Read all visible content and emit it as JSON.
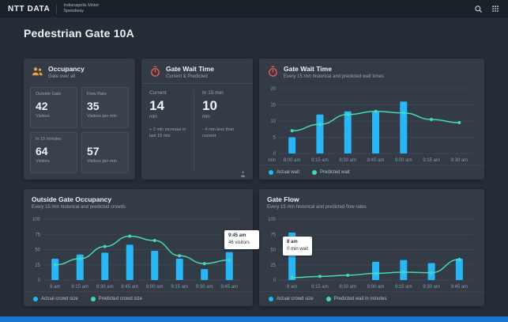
{
  "topbar": {
    "logo": "NTT DATA",
    "org_line1": "Indianapolis Motor",
    "org_line2": "Speedway"
  },
  "page": {
    "title": "Pedestrian Gate 10A"
  },
  "colors": {
    "accent_blue": "#29b6f6",
    "accent_teal": "#43d9b8",
    "icon_orange": "#f0a13c",
    "icon_red": "#ff5b50",
    "bottom_bar": "#1976d2"
  },
  "occupancy_card": {
    "title": "Occupancy",
    "subtitle": "Gate over all",
    "stats": [
      {
        "label": "Outside Gate",
        "value": "42",
        "unit": "Visitors"
      },
      {
        "label": "Flow Rate",
        "value": "35",
        "unit": "Visitors per min"
      },
      {
        "label": "In 15 minutes",
        "value": "64",
        "unit": "Visitors"
      },
      {
        "label": "",
        "value": "57",
        "unit": "Visitors per min"
      }
    ]
  },
  "wait_card": {
    "title": "Gate Wait Time",
    "subtitle": "Current & Predicted",
    "current": {
      "label": "Current",
      "value": "14",
      "unit": "min",
      "note": "+ 2 min increase in last 15 min"
    },
    "predicted": {
      "label": "In 15 min",
      "value": "10",
      "unit": "min",
      "note": "- 4 min less than current"
    }
  },
  "charts": [
    {
      "title": "Gate Wait Time",
      "subtitle": "Every 15 min historical and predicted wait times",
      "chart": {
        "type": "bar+line",
        "categories": [
          "8:00 am",
          "8:15 am",
          "8:30 am",
          "8:45 am",
          "9:00 am",
          "9:15 am",
          "9:30 am"
        ],
        "y_ticks": [
          0,
          5,
          10,
          15,
          20
        ],
        "y_unit": "min",
        "grid": true,
        "legend_position": "bottom",
        "series": [
          {
            "name": "Actual wait",
            "type": "bar",
            "color": "#29b6f6",
            "values": [
              5,
              12,
              13,
              13,
              16,
              null,
              null
            ]
          },
          {
            "name": "Predicted wait",
            "type": "line",
            "color": "#43d9b8",
            "values": [
              7,
              9,
              12,
              13,
              12.5,
              10.5,
              9.5
            ]
          }
        ]
      }
    },
    {
      "title": "Outside Gate Occupancy",
      "subtitle": "Every 15 min historical and predicted crowds",
      "chart": {
        "type": "bar+line",
        "categories": [
          "8 am",
          "8:15 am",
          "8:30 am",
          "8:45 am",
          "9:00 am",
          "9:15 am",
          "9:30 am",
          "9:45 am"
        ],
        "y_ticks": [
          0,
          25,
          50,
          75,
          100
        ],
        "y_unit": "",
        "grid": true,
        "legend_position": "bottom",
        "series": [
          {
            "name": "Actual crowd size",
            "type": "bar",
            "color": "#29b6f6",
            "values": [
              35,
              42,
              45,
              58,
              48,
              35,
              18,
              46
            ]
          },
          {
            "name": "Predicted crowd size",
            "type": "line",
            "color": "#43d9b8",
            "values": [
              25,
              35,
              55,
              72,
              65,
              40,
              27,
              33
            ]
          }
        ]
      },
      "tooltip": {
        "title": "9:45 am",
        "text": "46 visitors"
      }
    },
    {
      "title": "Gate Flow",
      "subtitle": "Every 15 min historical and predicted flow rates",
      "chart": {
        "type": "bar+line",
        "categories": [
          "8 am",
          "8:15 am",
          "8:30 am",
          "9:00 am",
          "9:15 am",
          "9:30 am",
          "9:45 am"
        ],
        "y_ticks": [
          0,
          25,
          50,
          75,
          100
        ],
        "y_unit": "",
        "grid": true,
        "legend_position": "bottom",
        "series": [
          {
            "name": "Actual crowd size",
            "type": "bar",
            "color": "#29b6f6",
            "values": [
              78,
              null,
              null,
              30,
              33,
              28,
              35
            ]
          },
          {
            "name": "Predicted wait in minutes",
            "type": "line",
            "color": "#43d9b8",
            "values": [
              4,
              6,
              8,
              11,
              13,
              12,
              34
            ]
          }
        ]
      },
      "tooltip": {
        "title": "8 am",
        "text": "0 min wait"
      }
    }
  ]
}
